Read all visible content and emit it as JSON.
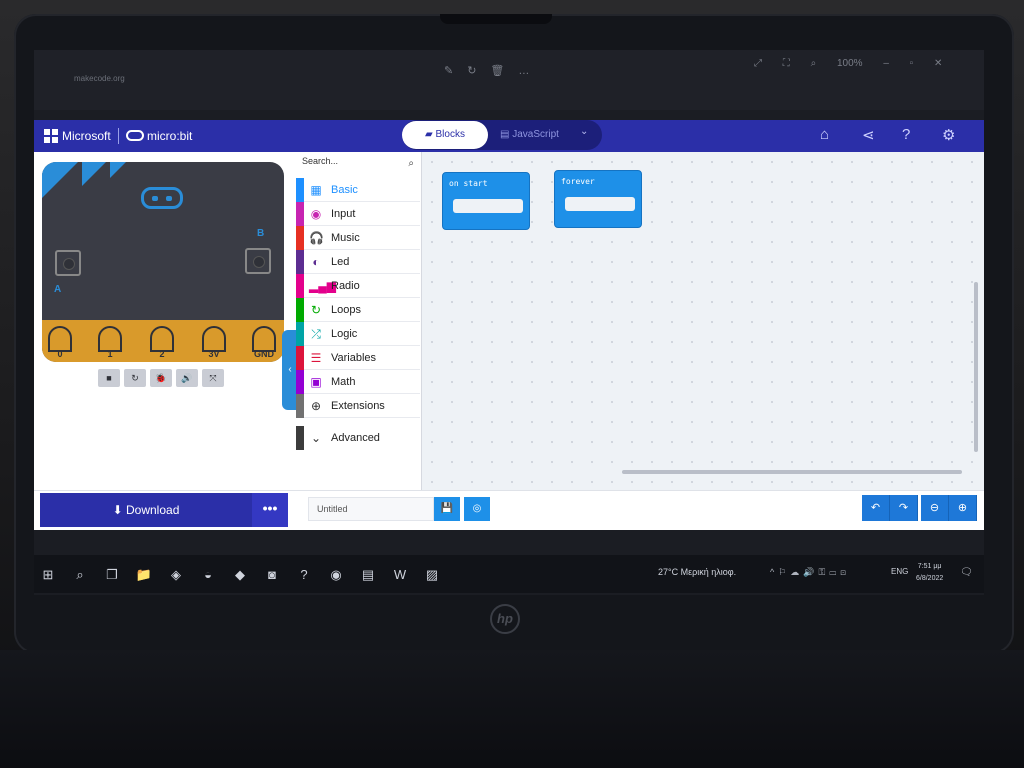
{
  "chrome": {
    "url": "makecode.org",
    "zoom": "100%"
  },
  "header": {
    "brand": "Microsoft",
    "product": "micro:bit",
    "tabs": [
      {
        "label": "Blocks",
        "selected": true
      },
      {
        "label": "JavaScript",
        "selected": false
      }
    ],
    "icons": [
      "home-icon",
      "share-icon",
      "help-icon",
      "settings-icon"
    ]
  },
  "simulator": {
    "button_a": "A",
    "button_b": "B",
    "pins": [
      "0",
      "1",
      "2",
      "3V",
      "GND"
    ],
    "controls": [
      "stop-icon",
      "restart-icon",
      "slowmo-icon",
      "sound-icon",
      "fullscreen-icon"
    ]
  },
  "toolbox": {
    "search_placeholder": "Search...",
    "categories": [
      {
        "label": "Basic",
        "color": "#1e90ff",
        "icon": "grid-icon"
      },
      {
        "label": "Input",
        "color": "#c724b1",
        "icon": "input-icon"
      },
      {
        "label": "Music",
        "color": "#e63022",
        "icon": "headphones-icon"
      },
      {
        "label": "Led",
        "color": "#5c2d91",
        "icon": "toggle-icon"
      },
      {
        "label": "Radio",
        "color": "#e3008c",
        "icon": "signal-icon"
      },
      {
        "label": "Loops",
        "color": "#00aa00",
        "icon": "loop-icon"
      },
      {
        "label": "Logic",
        "color": "#00a4a6",
        "icon": "shuffle-icon"
      },
      {
        "label": "Variables",
        "color": "#dc143c",
        "icon": "lines-icon"
      },
      {
        "label": "Math",
        "color": "#9400d3",
        "icon": "calculator-icon"
      },
      {
        "label": "Extensions",
        "color": "#717171",
        "icon": "plus-icon"
      },
      {
        "label": "Advanced",
        "color": "#3c3c3c",
        "icon": "chevron-down-icon"
      }
    ]
  },
  "canvas": {
    "blocks": [
      {
        "label": "on start"
      },
      {
        "label": "forever"
      }
    ]
  },
  "bottombar": {
    "download_label": "Download",
    "more_label": "•••",
    "project_name": "Untitled"
  },
  "taskbar": {
    "weather": "27°C  Μερική ηλιοφ.",
    "lang": "ENG",
    "time": "7:51 μμ",
    "date": "6/8/2022"
  }
}
